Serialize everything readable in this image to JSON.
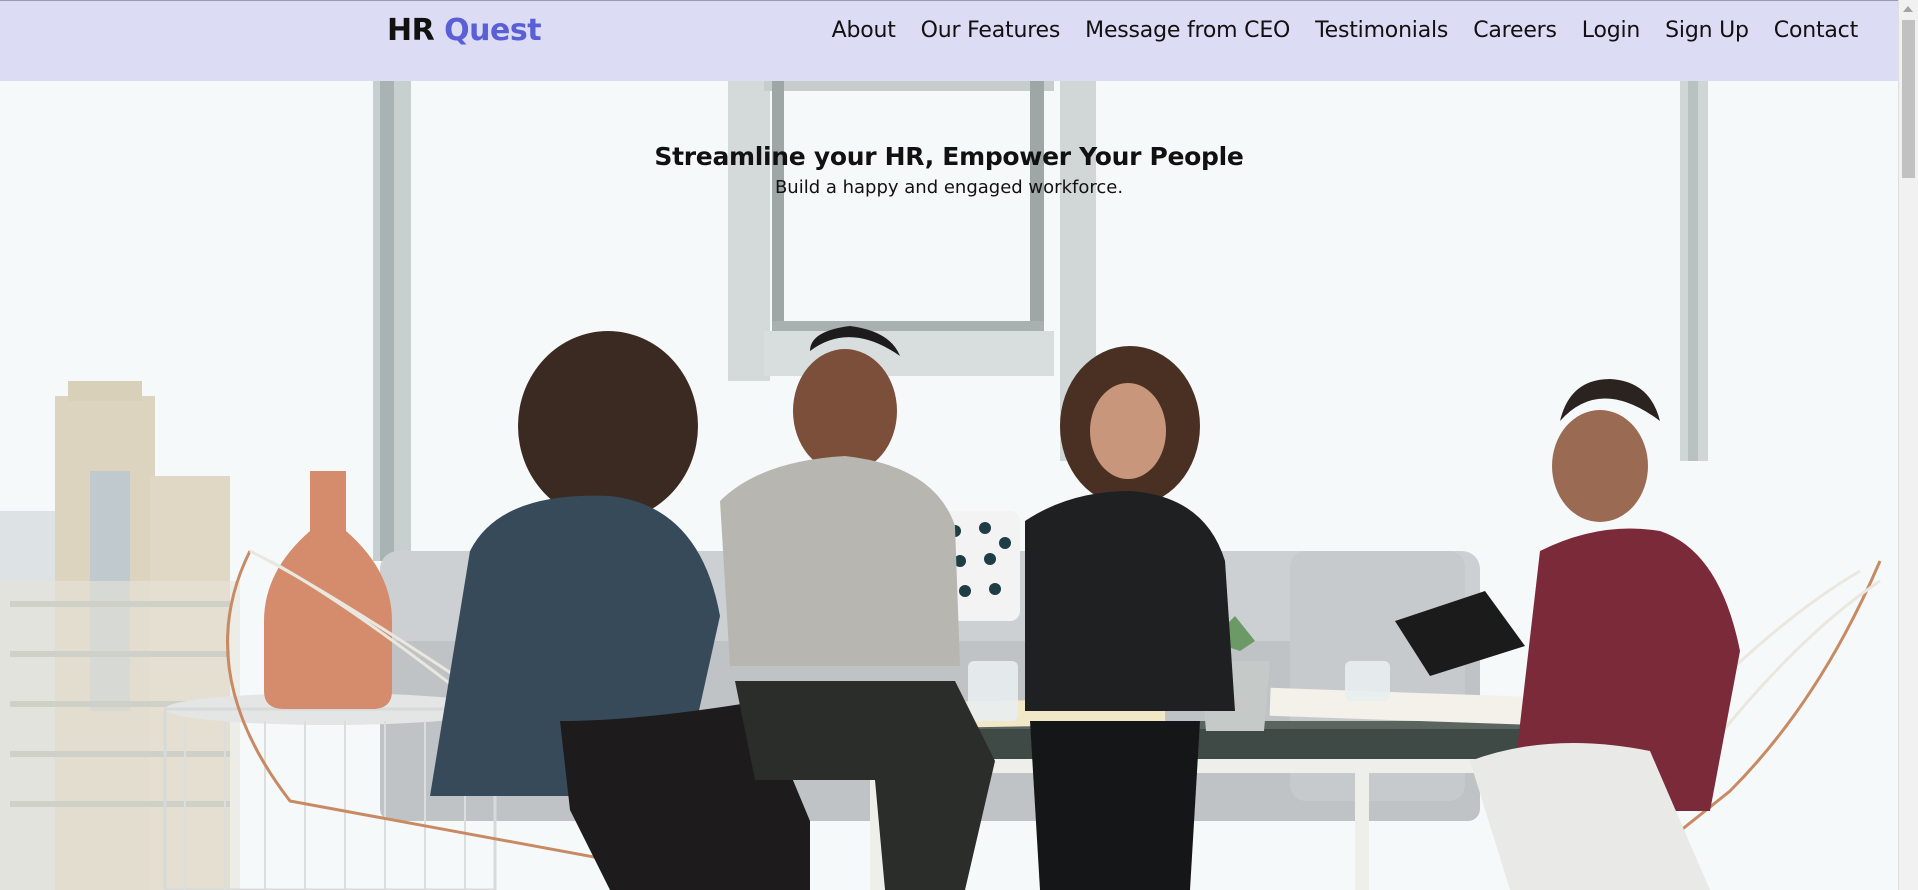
{
  "brand": {
    "name_part1": "HR",
    "name_part2": "Quest",
    "accent_color": "#5b5fd6"
  },
  "nav": {
    "background_color": "#dcdcf5",
    "items": [
      {
        "label": "About"
      },
      {
        "label": "Our Features"
      },
      {
        "label": "Message from CEO"
      },
      {
        "label": "Testimonials"
      },
      {
        "label": "Careers"
      },
      {
        "label": "Login"
      },
      {
        "label": "Sign Up"
      },
      {
        "label": "Contact"
      }
    ]
  },
  "hero": {
    "title": "Streamline your HR, Empower Your People",
    "subtitle": "Build a happy and engaged workforce.",
    "image_description_icon": "team-meeting-photo"
  }
}
